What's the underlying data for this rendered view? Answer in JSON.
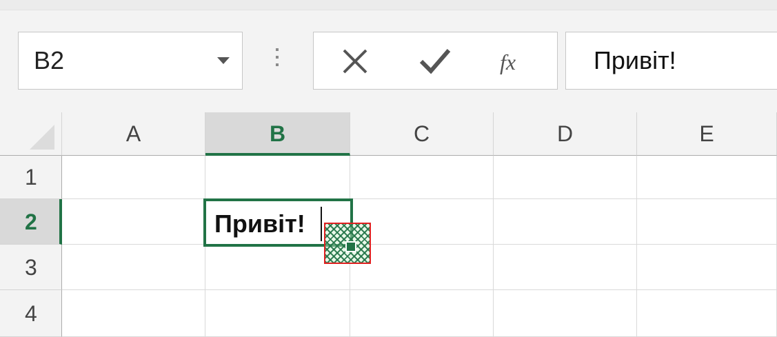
{
  "name_box": {
    "value": "B2"
  },
  "formula_bar": {
    "cancel_icon": "close-icon",
    "enter_icon": "check-icon",
    "function_label": "fx",
    "content": "Привіт!"
  },
  "columns": [
    "A",
    "B",
    "C",
    "D",
    "E"
  ],
  "rows": [
    "1",
    "2",
    "3",
    "4"
  ],
  "selected": {
    "column": "B",
    "row": "2"
  },
  "cells": {
    "B2": "Привіт!"
  },
  "colors": {
    "accent": "#217346",
    "highlight_border": "#e02020"
  }
}
